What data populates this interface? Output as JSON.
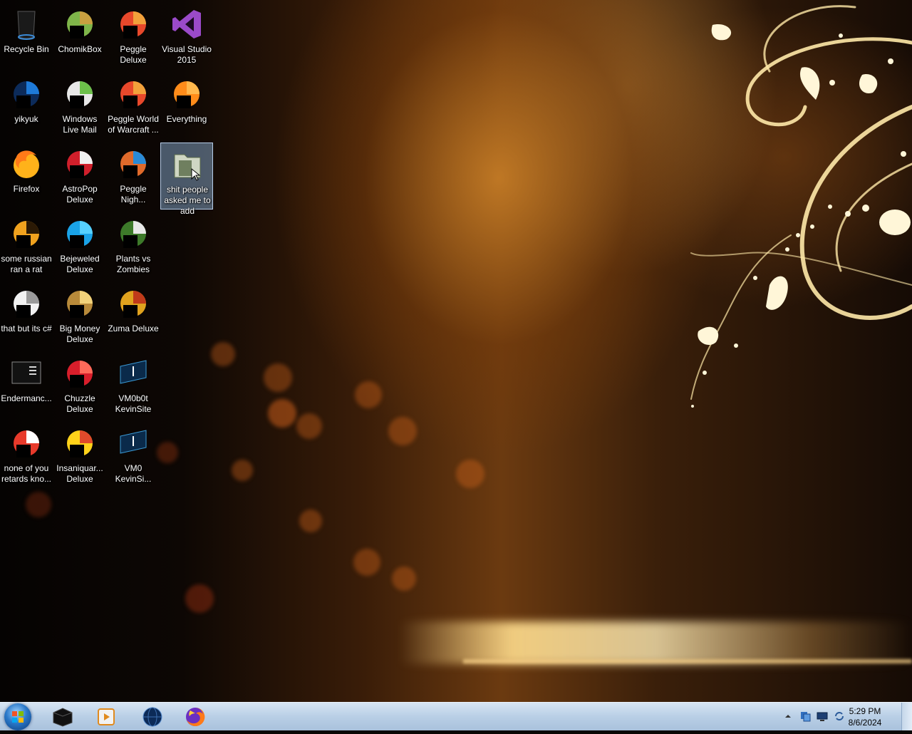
{
  "desktop": {
    "icons": [
      {
        "label": "Recycle Bin",
        "icon": "recycle-bin-icon"
      },
      {
        "label": "ChomikBox",
        "icon": "chomikbox-icon"
      },
      {
        "label": "Peggle Deluxe",
        "icon": "peggle-icon"
      },
      {
        "label": "Visual Studio 2015",
        "icon": "visual-studio-icon"
      },
      {
        "label": "yikyuk",
        "icon": "phone-icon"
      },
      {
        "label": "Windows Live Mail",
        "icon": "mail-icon"
      },
      {
        "label": "Peggle World of Warcraft ...",
        "icon": "peggle-icon"
      },
      {
        "label": "Everything",
        "icon": "search-icon"
      },
      {
        "label": "Firefox",
        "icon": "firefox-icon"
      },
      {
        "label": "AstroPop Deluxe",
        "icon": "astropop-icon"
      },
      {
        "label": "Peggle Nigh...",
        "icon": "peggle-nights-icon"
      },
      {
        "label": "shit people asked me to add",
        "icon": "folder-icon"
      },
      {
        "label": "some russian ran a rat",
        "icon": "shortcut-e-icon"
      },
      {
        "label": "Bejeweled Deluxe",
        "icon": "bejeweled-icon"
      },
      {
        "label": "Plants vs Zombies",
        "icon": "plants-vs-zombies-icon"
      },
      {
        "label": "that but its c#",
        "icon": "windows-stack-icon"
      },
      {
        "label": "Big Money Deluxe",
        "icon": "big-money-icon"
      },
      {
        "label": "Zuma Deluxe",
        "icon": "zuma-icon"
      },
      {
        "label": "Endermanc...",
        "icon": "terminal-icon"
      },
      {
        "label": "Chuzzle Deluxe",
        "icon": "chuzzle-icon"
      },
      {
        "label": "VM0b0t KevinSite",
        "icon": "vm-icon"
      },
      {
        "label": "none of you retards kno...",
        "icon": "app-icon"
      },
      {
        "label": "Insaniquar... Deluxe",
        "icon": "insaniquarium-icon"
      },
      {
        "label": "VM0 KevinSi...",
        "icon": "vm-icon"
      }
    ]
  },
  "taskbar": {
    "pinned": [
      {
        "name": "command-prompt-icon"
      },
      {
        "name": "media-player-icon"
      },
      {
        "name": "globe-icon"
      },
      {
        "name": "firefox-icon"
      }
    ],
    "tray_icons": [
      "show-hidden-icons-arrow",
      "network-icon",
      "monitor-icon",
      "sync-icon"
    ],
    "time": "5:29 PM",
    "date": "8/6/2024"
  }
}
